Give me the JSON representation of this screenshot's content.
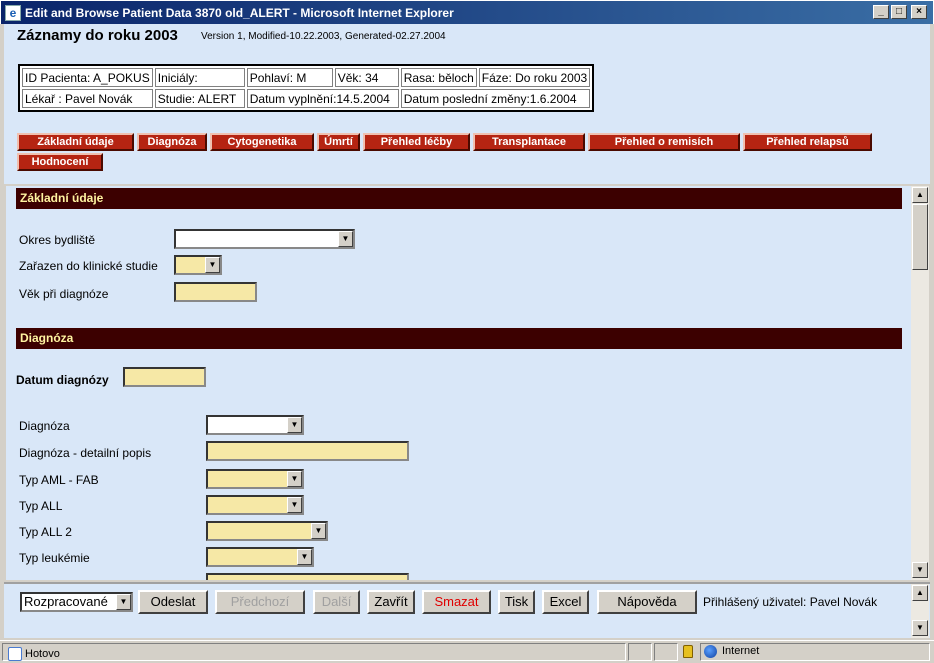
{
  "window": {
    "title": "Edit and Browse Patient Data 3870 old_ALERT - Microsoft Internet Explorer",
    "min": "_",
    "max": "□",
    "close": "×"
  },
  "page": {
    "title": "Záznamy do roku 2003",
    "subtitle": "Version 1, Modified-10.22.2003, Generated-02.27.2004"
  },
  "info": {
    "row1": [
      "ID Pacienta: A_POKUS",
      "Iniciály:",
      "Pohlaví: M",
      "Věk: 34",
      "Rasa: běloch",
      "Fáze: Do roku 2003"
    ],
    "row2": [
      "Lékař : Pavel Novák",
      "Studie: ALERT",
      "Datum vyplnění:14.5.2004",
      "Datum poslední změny:1.6.2004"
    ]
  },
  "tabs": [
    "Základní údaje",
    "Diagnóza",
    "Cytogenetika",
    "Úmrtí",
    "Přehled léčby",
    "Transplantace",
    "Přehled o remisích",
    "Přehled relapsů",
    "Hodnocení"
  ],
  "sections": {
    "basic": {
      "title": "Základní údaje",
      "okres_label": "Okres bydliště",
      "klinicka_label": "Zařazen do klinické studie",
      "vek_label": "Věk při diagnóze"
    },
    "diag": {
      "title": "Diagnóza",
      "datum_label": "Datum diagnózy",
      "diagnoza_label": "Diagnóza",
      "detail_label": "Diagnóza - detailní popis",
      "aml_label": "Typ AML - FAB",
      "all_label": "Typ ALL",
      "all2_label": "Typ ALL 2",
      "leuk_label": "Typ leukémie"
    }
  },
  "bottom": {
    "status_value": "Rozpracované",
    "buttons": {
      "send": "Odeslat",
      "prev": "Předchozí",
      "next": "Další",
      "close": "Zavřít",
      "delete": "Smazat",
      "print": "Tisk",
      "excel": "Excel",
      "help": "Nápověda"
    },
    "user": "Přihlášený uživatel: Pavel Novák"
  },
  "statusbar": {
    "text": "Hotovo",
    "zone": "Internet"
  },
  "colors": {
    "section_bg": "#3c0000",
    "section_text": "#fff3a0",
    "tab_bg": "#b52412",
    "field_bg": "#f6e8a6",
    "page_bg": "#d9e7f8"
  }
}
